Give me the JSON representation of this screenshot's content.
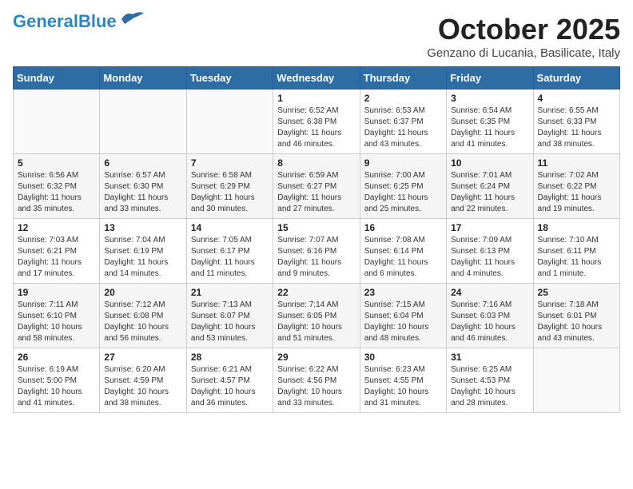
{
  "header": {
    "logo_line1": "General",
    "logo_line2": "Blue",
    "main_title": "October 2025",
    "subtitle": "Genzano di Lucania, Basilicate, Italy"
  },
  "weekdays": [
    "Sunday",
    "Monday",
    "Tuesday",
    "Wednesday",
    "Thursday",
    "Friday",
    "Saturday"
  ],
  "weeks": [
    [
      {
        "day": "",
        "info": ""
      },
      {
        "day": "",
        "info": ""
      },
      {
        "day": "",
        "info": ""
      },
      {
        "day": "1",
        "info": "Sunrise: 6:52 AM\nSunset: 6:38 PM\nDaylight: 11 hours\nand 46 minutes."
      },
      {
        "day": "2",
        "info": "Sunrise: 6:53 AM\nSunset: 6:37 PM\nDaylight: 11 hours\nand 43 minutes."
      },
      {
        "day": "3",
        "info": "Sunrise: 6:54 AM\nSunset: 6:35 PM\nDaylight: 11 hours\nand 41 minutes."
      },
      {
        "day": "4",
        "info": "Sunrise: 6:55 AM\nSunset: 6:33 PM\nDaylight: 11 hours\nand 38 minutes."
      }
    ],
    [
      {
        "day": "5",
        "info": "Sunrise: 6:56 AM\nSunset: 6:32 PM\nDaylight: 11 hours\nand 35 minutes."
      },
      {
        "day": "6",
        "info": "Sunrise: 6:57 AM\nSunset: 6:30 PM\nDaylight: 11 hours\nand 33 minutes."
      },
      {
        "day": "7",
        "info": "Sunrise: 6:58 AM\nSunset: 6:29 PM\nDaylight: 11 hours\nand 30 minutes."
      },
      {
        "day": "8",
        "info": "Sunrise: 6:59 AM\nSunset: 6:27 PM\nDaylight: 11 hours\nand 27 minutes."
      },
      {
        "day": "9",
        "info": "Sunrise: 7:00 AM\nSunset: 6:25 PM\nDaylight: 11 hours\nand 25 minutes."
      },
      {
        "day": "10",
        "info": "Sunrise: 7:01 AM\nSunset: 6:24 PM\nDaylight: 11 hours\nand 22 minutes."
      },
      {
        "day": "11",
        "info": "Sunrise: 7:02 AM\nSunset: 6:22 PM\nDaylight: 11 hours\nand 19 minutes."
      }
    ],
    [
      {
        "day": "12",
        "info": "Sunrise: 7:03 AM\nSunset: 6:21 PM\nDaylight: 11 hours\nand 17 minutes."
      },
      {
        "day": "13",
        "info": "Sunrise: 7:04 AM\nSunset: 6:19 PM\nDaylight: 11 hours\nand 14 minutes."
      },
      {
        "day": "14",
        "info": "Sunrise: 7:05 AM\nSunset: 6:17 PM\nDaylight: 11 hours\nand 11 minutes."
      },
      {
        "day": "15",
        "info": "Sunrise: 7:07 AM\nSunset: 6:16 PM\nDaylight: 11 hours\nand 9 minutes."
      },
      {
        "day": "16",
        "info": "Sunrise: 7:08 AM\nSunset: 6:14 PM\nDaylight: 11 hours\nand 6 minutes."
      },
      {
        "day": "17",
        "info": "Sunrise: 7:09 AM\nSunset: 6:13 PM\nDaylight: 11 hours\nand 4 minutes."
      },
      {
        "day": "18",
        "info": "Sunrise: 7:10 AM\nSunset: 6:11 PM\nDaylight: 11 hours\nand 1 minute."
      }
    ],
    [
      {
        "day": "19",
        "info": "Sunrise: 7:11 AM\nSunset: 6:10 PM\nDaylight: 10 hours\nand 58 minutes."
      },
      {
        "day": "20",
        "info": "Sunrise: 7:12 AM\nSunset: 6:08 PM\nDaylight: 10 hours\nand 56 minutes."
      },
      {
        "day": "21",
        "info": "Sunrise: 7:13 AM\nSunset: 6:07 PM\nDaylight: 10 hours\nand 53 minutes."
      },
      {
        "day": "22",
        "info": "Sunrise: 7:14 AM\nSunset: 6:05 PM\nDaylight: 10 hours\nand 51 minutes."
      },
      {
        "day": "23",
        "info": "Sunrise: 7:15 AM\nSunset: 6:04 PM\nDaylight: 10 hours\nand 48 minutes."
      },
      {
        "day": "24",
        "info": "Sunrise: 7:16 AM\nSunset: 6:03 PM\nDaylight: 10 hours\nand 46 minutes."
      },
      {
        "day": "25",
        "info": "Sunrise: 7:18 AM\nSunset: 6:01 PM\nDaylight: 10 hours\nand 43 minutes."
      }
    ],
    [
      {
        "day": "26",
        "info": "Sunrise: 6:19 AM\nSunset: 5:00 PM\nDaylight: 10 hours\nand 41 minutes."
      },
      {
        "day": "27",
        "info": "Sunrise: 6:20 AM\nSunset: 4:59 PM\nDaylight: 10 hours\nand 38 minutes."
      },
      {
        "day": "28",
        "info": "Sunrise: 6:21 AM\nSunset: 4:57 PM\nDaylight: 10 hours\nand 36 minutes."
      },
      {
        "day": "29",
        "info": "Sunrise: 6:22 AM\nSunset: 4:56 PM\nDaylight: 10 hours\nand 33 minutes."
      },
      {
        "day": "30",
        "info": "Sunrise: 6:23 AM\nSunset: 4:55 PM\nDaylight: 10 hours\nand 31 minutes."
      },
      {
        "day": "31",
        "info": "Sunrise: 6:25 AM\nSunset: 4:53 PM\nDaylight: 10 hours\nand 28 minutes."
      },
      {
        "day": "",
        "info": ""
      }
    ]
  ]
}
